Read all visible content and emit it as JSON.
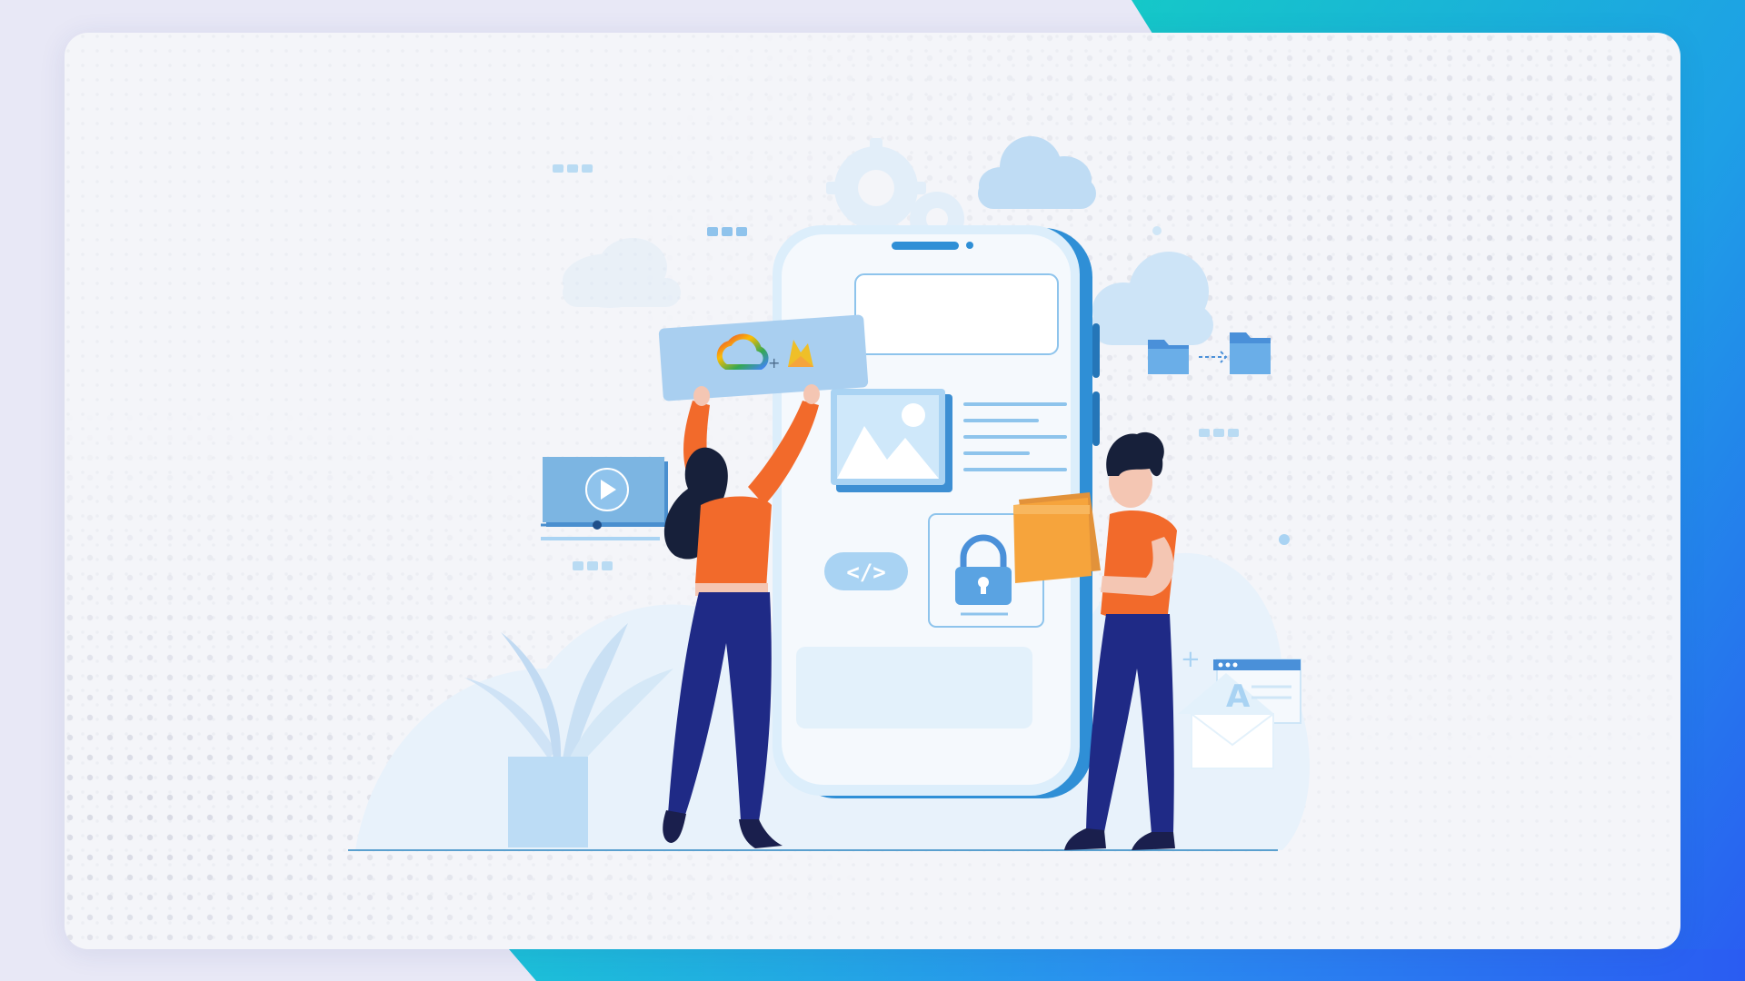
{
  "scene": {
    "icons": [
      "cloud-icon",
      "gear-icon",
      "folder-icon",
      "video-play-icon",
      "code-brackets-icon",
      "lock-icon",
      "image-icon",
      "email-icon",
      "google-cloud-logo",
      "firebase-logo"
    ],
    "banner_plus": "+",
    "code_symbol": "</>",
    "email_letter": "A"
  },
  "colors": {
    "backdrop": "#e8e8f6",
    "card": "#f4f5f9",
    "accent_gradient_start": "#14c7c9",
    "accent_gradient_end": "#2a5cf2",
    "phone_frame": "#2f8fd6",
    "phone_screen": "#f5f9fd",
    "shirt_orange": "#f26a2b",
    "pants_navy": "#1f2a86",
    "folder_yellow": "#f6a43c",
    "light_blue": "#a9d3f3"
  }
}
